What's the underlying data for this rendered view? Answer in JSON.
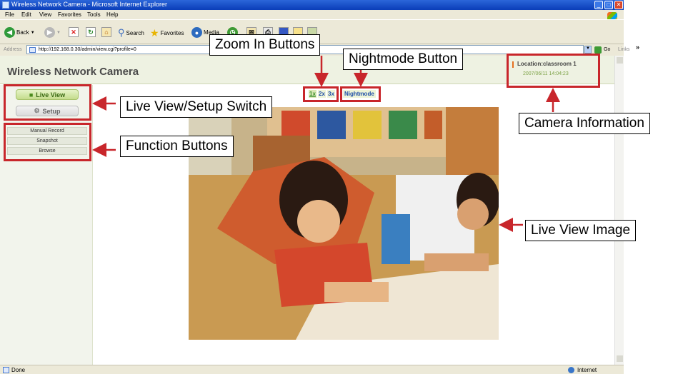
{
  "window": {
    "title": "Wireless Network Camera - Microsoft Internet Explorer"
  },
  "menu": [
    "File",
    "Edit",
    "View",
    "Favorites",
    "Tools",
    "Help"
  ],
  "toolbar": {
    "back": "Back",
    "search": "Search",
    "favorites": "Favorites",
    "media": "Media"
  },
  "address": {
    "label": "Address",
    "url": "http://192.168.0.30/admin/view.cgi?profile=0",
    "go": "Go",
    "links": "Links"
  },
  "page": {
    "title": "Wireless Network Camera"
  },
  "modes": {
    "live_view": "Live View",
    "setup": "Setup"
  },
  "functions": [
    "Manual Record",
    "Snapshot",
    "Browse"
  ],
  "zoom": [
    "1x",
    "2x",
    "3x"
  ],
  "nightmode": "Nightmode",
  "camera_info": {
    "location": "Location:classroom 1",
    "datetime": "2007/06/11 14:04:23"
  },
  "status": {
    "left": "Done",
    "right": "Internet"
  },
  "callouts": {
    "zoom": "Zoom In Buttons",
    "nightmode": "Nightmode Button",
    "switch": "Live View/Setup Switch",
    "functions": "Function Buttons",
    "camera": "Camera Information",
    "live_image": "Live View Image"
  },
  "colors": {
    "callout_red": "#c8262b",
    "title_bar": "#0a3db8",
    "live_green": "#3b6a13"
  }
}
